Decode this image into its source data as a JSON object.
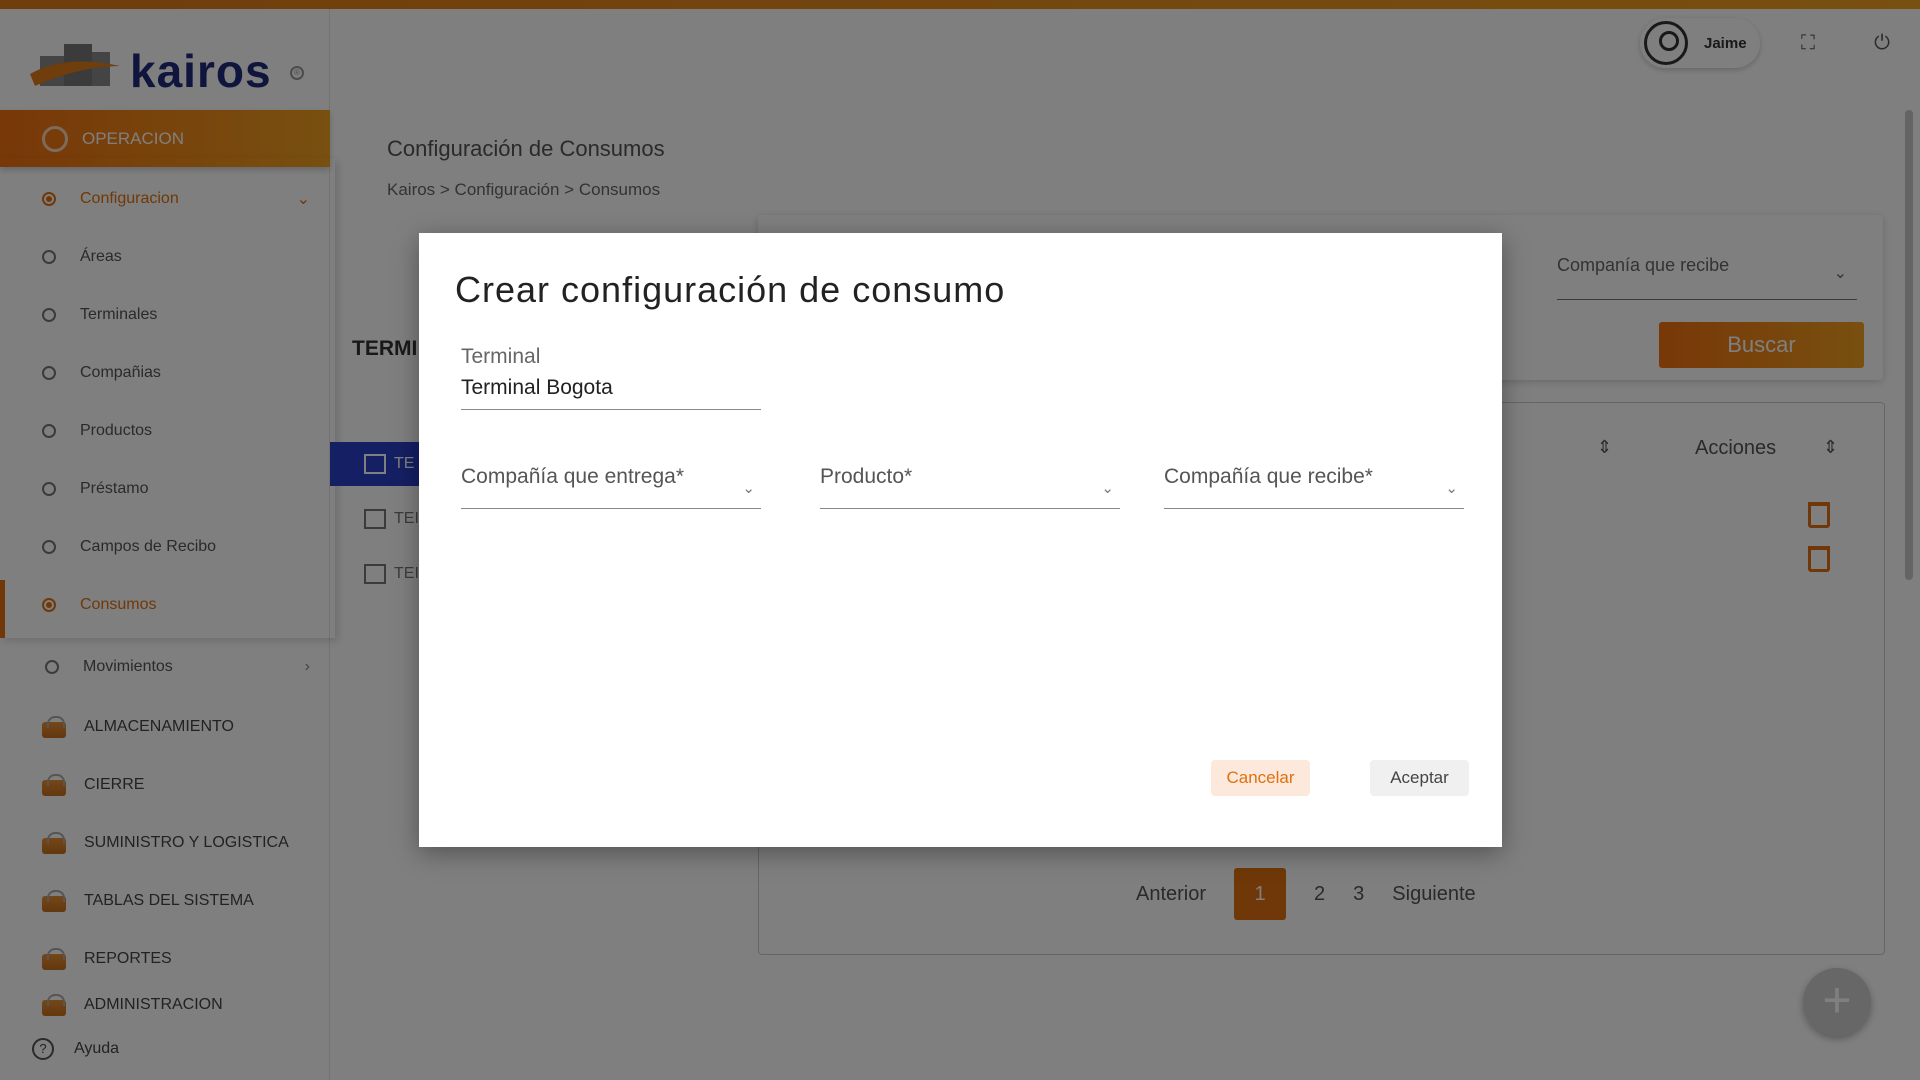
{
  "app": {
    "brand": "kairos"
  },
  "header": {
    "user_name": "Jaime"
  },
  "sidebar": {
    "module_active": "OPERACION",
    "submenu": [
      {
        "label": "Configuracion"
      },
      {
        "label": "Áreas"
      },
      {
        "label": "Terminales"
      },
      {
        "label": "Compañias"
      },
      {
        "label": "Productos"
      },
      {
        "label": "Préstamo"
      },
      {
        "label": "Campos de Recibo"
      },
      {
        "label": "Consumos"
      },
      {
        "label": "Movimientos"
      }
    ],
    "modules": [
      {
        "label": "ALMACENAMIENTO"
      },
      {
        "label": "CIERRE"
      },
      {
        "label": "SUMINISTRO Y LOGISTICA"
      },
      {
        "label": "TABLAS DEL SISTEMA"
      },
      {
        "label": "REPORTES"
      },
      {
        "label": "ADMINISTRACION"
      }
    ],
    "help": "Ayuda"
  },
  "page": {
    "title": "Configuración de Consumos",
    "breadcrumb": "Kairos > Configuración >  Consumos",
    "terminals_title": "TERMI",
    "terminal_rows": [
      "TE",
      "TEI",
      "TEI"
    ]
  },
  "filters": {
    "recibe_placeholder": "Companía que recibe",
    "search_button": "Buscar"
  },
  "table": {
    "col_acciones": "Acciones"
  },
  "pagination": {
    "prev": "Anterior",
    "pages": [
      "1",
      "2",
      "3"
    ],
    "current": "1",
    "next": "Siguiente"
  },
  "dialog": {
    "title": "Crear configuración de consumo",
    "terminal_label": "Terminal",
    "terminal_value": "Terminal Bogota",
    "entrega_label": "Compañía que entrega*",
    "producto_label": "Producto*",
    "recibe_label": "Compañía que recibe*",
    "cancel": "Cancelar",
    "accept": "Aceptar"
  }
}
